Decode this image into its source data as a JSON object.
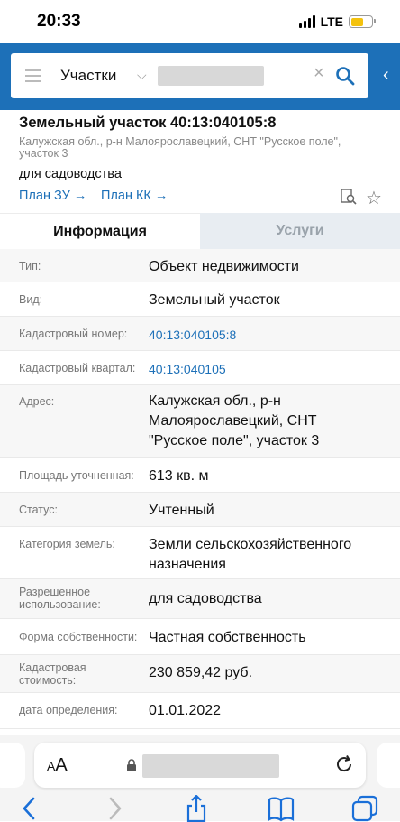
{
  "status_bar": {
    "time": "20:33",
    "network": "LTE"
  },
  "search": {
    "menu_icon": "hamburger-icon",
    "type_label": "Участки",
    "query": "",
    "clear_icon": "close-icon",
    "search_icon": "search-icon"
  },
  "parcel": {
    "title": "Земельный участок 40:13:040105:8",
    "address": "Калужская обл., р-н Малоярославецкий, СНТ \"Русское поле\", участок 3",
    "purpose": "для садоводства",
    "plan_zu": "План ЗУ",
    "plan_kk": "План КК"
  },
  "tabs": {
    "info": "Информация",
    "services": "Услуги"
  },
  "info": {
    "rows": [
      {
        "label": "Тип:",
        "value": "Объект недвижимости"
      },
      {
        "label": "Вид:",
        "value": "Земельный участок"
      },
      {
        "label": "Кадастровый номер:",
        "value": "40:13:040105:8"
      },
      {
        "label": "Кадастровый квартал:",
        "value": "40:13:040105"
      },
      {
        "label": "Адрес:",
        "value": "Калужская обл., р-н Малоярославецкий, СНТ \"Русское поле\", участок 3"
      },
      {
        "label": "Площадь уточненная:",
        "value": "613 кв. м"
      },
      {
        "label": "Статус:",
        "value": "Учтенный"
      },
      {
        "label": "Категория земель:",
        "value": "Земли сельскохозяйственного назначения"
      },
      {
        "label": "Разрешенное использование:",
        "value": "для садоводства"
      },
      {
        "label": "Форма собственности:",
        "value": "Частная собственность"
      },
      {
        "label": "Кадастровая стоимость:",
        "value": "230 859,42 руб."
      },
      {
        "label": "дата определения:",
        "value": "01.01.2022"
      }
    ]
  },
  "browser": {
    "text_size_label": "AA",
    "url": ""
  },
  "colors": {
    "brand": "#1d70b8",
    "link": "#1d70b8",
    "battery": "#f4c20d"
  }
}
